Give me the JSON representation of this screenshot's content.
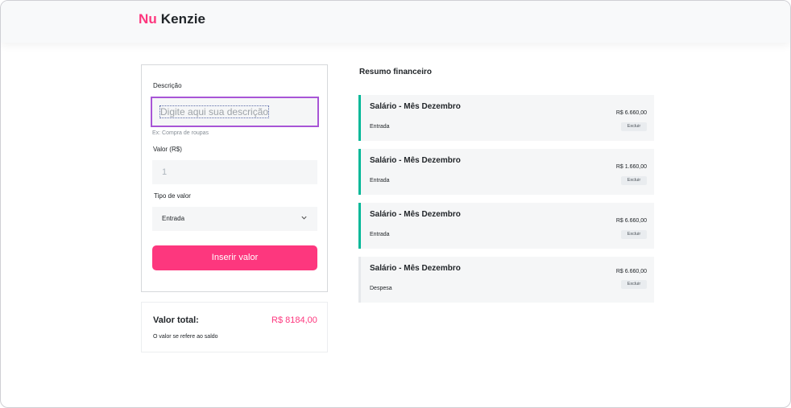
{
  "header": {
    "logo_nu": "Nu",
    "logo_kenzie": "Kenzie"
  },
  "form": {
    "description_label": "Descrição",
    "description_placeholder": "Digite aqui sua descrição",
    "description_hint": "Ex: Compra de roupas",
    "value_label": "Valor (R$)",
    "value_placeholder": "1",
    "type_label": "Tipo de valor",
    "type_selected": "Entrada",
    "submit_label": "Inserir valor"
  },
  "total": {
    "label": "Valor total:",
    "value": "R$ 8184,00",
    "note": "O valor se refere ao saldo"
  },
  "summary": {
    "title": "Resumo financeiro",
    "entries": [
      {
        "title": "Salário - Mês Dezembro",
        "type": "Entrada",
        "amount": "R$ 6.660,00",
        "delete_label": "Excluir"
      },
      {
        "title": "Salário - Mês Dezembro",
        "type": "Entrada",
        "amount": "R$ 1.660,00",
        "delete_label": "Excluir"
      },
      {
        "title": "Salário - Mês Dezembro",
        "type": "Entrada",
        "amount": "R$ 6.660,00",
        "delete_label": "Excluir"
      },
      {
        "title": "Salário - Mês Dezembro",
        "type": "Despesa",
        "amount": "R$ 6.660,00",
        "delete_label": "Excluir"
      }
    ]
  },
  "colors": {
    "brand": "#fd377e",
    "income_accent": "#03b898",
    "expense_accent": "#e6e8eb",
    "focus_border": "#a855d6"
  },
  "icons": {
    "select_arrow": "chevron-down-icon"
  }
}
